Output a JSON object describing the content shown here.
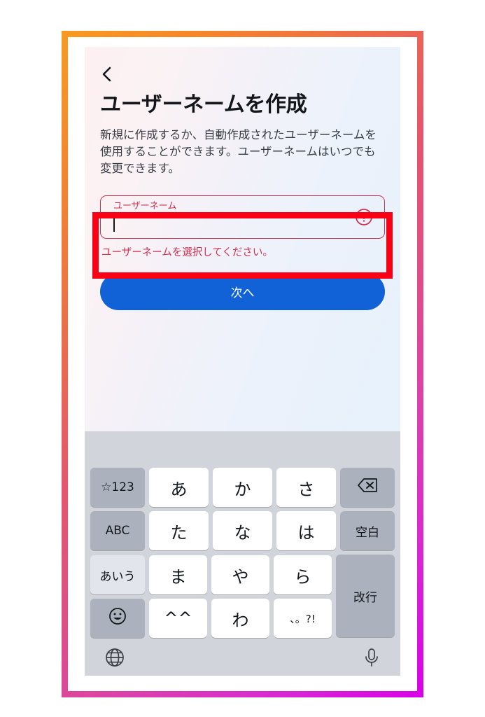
{
  "frame": {
    "gradient_start": "#f99a1f",
    "gradient_mid": "#e14d86",
    "gradient_end": "#d900e8"
  },
  "annotation": {
    "color": "#fa0015",
    "target": "username-field"
  },
  "app": {
    "back_icon": "chevron-left-icon",
    "title": "ユーザーネームを作成",
    "description": "新規に作成するか、自動作成されたユーザーネームを使用することができます。ユーザーネームはいつでも変更できます。",
    "field": {
      "label": "ユーザーネーム",
      "value": "",
      "placeholder": "",
      "error_icon": "error-circle-icon",
      "border_color": "#d03055",
      "label_color": "#cf3050"
    },
    "error_message": "ユーザーネームを選択してください。",
    "next_button": {
      "label": "次へ",
      "color": "#1062d6"
    }
  },
  "keyboard": {
    "background": "#d1d4da",
    "rows": [
      [
        {
          "label": "☆123",
          "style": "dark",
          "size": "small",
          "name": "key-symbols-123"
        },
        {
          "label": "あ",
          "style": "light",
          "size": "normal",
          "name": "key-a"
        },
        {
          "label": "か",
          "style": "light",
          "size": "normal",
          "name": "key-ka"
        },
        {
          "label": "さ",
          "style": "light",
          "size": "normal",
          "name": "key-sa"
        },
        {
          "label": "",
          "style": "dark",
          "size": "normal",
          "name": "key-backspace",
          "icon": "backspace-icon"
        }
      ],
      [
        {
          "label": "ABC",
          "style": "dark",
          "size": "small",
          "name": "key-abc"
        },
        {
          "label": "た",
          "style": "light",
          "size": "normal",
          "name": "key-ta"
        },
        {
          "label": "な",
          "style": "light",
          "size": "normal",
          "name": "key-na"
        },
        {
          "label": "は",
          "style": "light",
          "size": "normal",
          "name": "key-ha"
        },
        {
          "label": "空白",
          "style": "dark",
          "size": "small",
          "name": "key-space"
        }
      ],
      [
        {
          "label": "あいう",
          "style": "pale",
          "size": "small",
          "name": "key-aiu"
        },
        {
          "label": "ま",
          "style": "light",
          "size": "normal",
          "name": "key-ma"
        },
        {
          "label": "や",
          "style": "light",
          "size": "normal",
          "name": "key-ya"
        },
        {
          "label": "ら",
          "style": "light",
          "size": "normal",
          "name": "key-ra"
        }
      ],
      [
        {
          "label": "",
          "style": "dark",
          "size": "normal",
          "name": "key-emoji",
          "icon": "emoji-icon"
        },
        {
          "label": "^^",
          "style": "light",
          "size": "normal",
          "name": "key-kaomoji"
        },
        {
          "label": "わ",
          "style": "light",
          "size": "normal",
          "name": "key-wa"
        },
        {
          "label": "、。?!",
          "style": "light",
          "size": "tiny",
          "name": "key-punctuation"
        }
      ]
    ],
    "return_key": {
      "label": "改行",
      "style": "dark",
      "name": "key-return"
    },
    "bottom_bar": {
      "globe_icon": "globe-icon",
      "mic_icon": "microphone-icon"
    }
  }
}
